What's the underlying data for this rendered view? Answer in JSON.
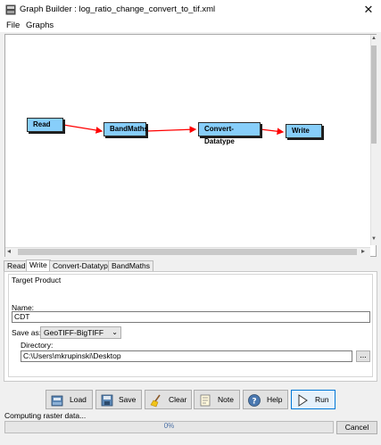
{
  "window": {
    "title": "Graph Builder : log_ratio_change_convert_to_tif.xml",
    "close_glyph": "✕"
  },
  "menu": [
    "File",
    "Graphs"
  ],
  "graph": {
    "nodes": [
      {
        "id": "read",
        "label": "Read"
      },
      {
        "id": "bandmaths",
        "label": "BandMaths"
      },
      {
        "id": "convert",
        "label": "Convert-Datatype"
      },
      {
        "id": "write",
        "label": "Write"
      }
    ],
    "node_color": "#87cefa",
    "edge_color": "#ff0000"
  },
  "tabs": [
    {
      "label": "Read",
      "active": false
    },
    {
      "label": "Write",
      "active": true
    },
    {
      "label": "Convert-Datatype",
      "active": false
    },
    {
      "label": "BandMaths",
      "active": false
    }
  ],
  "target_product": {
    "group_title": "Target Product",
    "name_label": "Name:",
    "name_value": "CDT",
    "save_as_label": "Save as:",
    "save_as_value": "GeoTIFF-BigTIFF",
    "directory_label": "Directory:",
    "directory_value": "C:\\Users\\mkrupinski\\Desktop",
    "browse_label": "..."
  },
  "buttons": [
    {
      "id": "load",
      "label": "Load",
      "icon": "folder-icon"
    },
    {
      "id": "save",
      "label": "Save",
      "icon": "save-icon"
    },
    {
      "id": "clear",
      "label": "Clear",
      "icon": "broom-icon"
    },
    {
      "id": "note",
      "label": "Note",
      "icon": "note-icon"
    },
    {
      "id": "help",
      "label": "Help",
      "icon": "help-icon"
    },
    {
      "id": "run",
      "label": "Run",
      "icon": "play-icon"
    }
  ],
  "status": {
    "text": "Computing raster data...",
    "progress_fraction": 0,
    "progress_text": "0%",
    "cancel_label": "Cancel"
  }
}
